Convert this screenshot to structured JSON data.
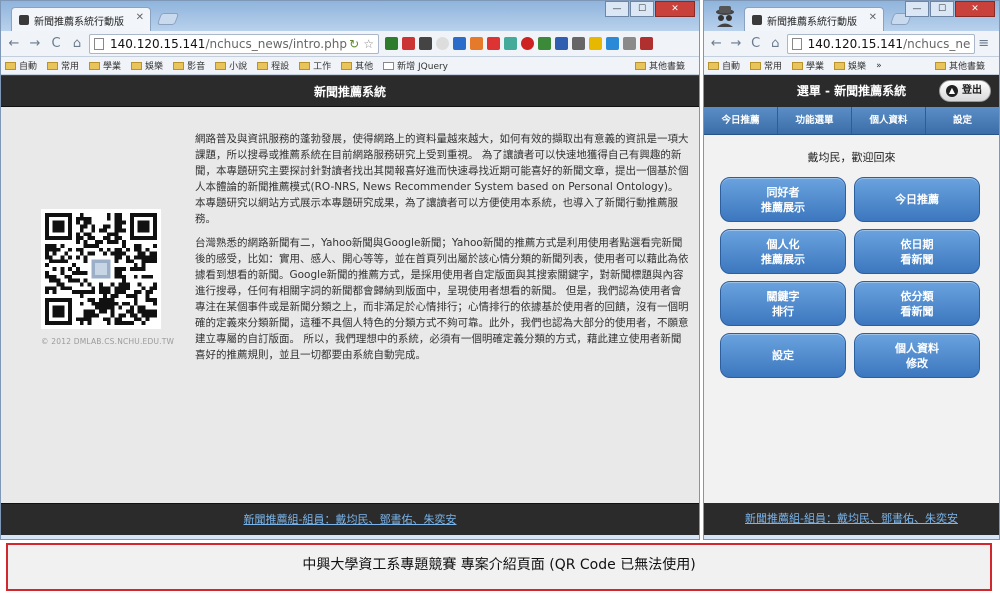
{
  "left_window": {
    "tab_title": "新聞推薦系統行動版",
    "address": {
      "host": "140.120.15.141",
      "path": "/nchucs_news/intro.php"
    },
    "bookmarks": [
      "自動",
      "常用",
      "學業",
      "娛樂",
      "影音",
      "小說",
      "程設",
      "工作",
      "其他",
      "新增 JQuery"
    ],
    "other_bookmarks": "其他書籤",
    "header_title": "新聞推薦系統",
    "qr_copyright": "© 2012 DMLAB.CS.NCHU.EDU.TW",
    "paragraphs": [
      "網路普及與資訊服務的蓬勃發展，使得網路上的資料量越來越大，如何有效的擷取出有意義的資訊是一項大課題，所以搜尋或推薦系統在目前網路服務研究上受到重視。 為了讓讀者可以快速地獲得自己有興趣的新聞，本專題研究主要探討針對讀者找出其閱報喜好進而快速尋找近期可能喜好的新聞文章，提出一個基於個人本體論的新聞推薦模式(RO-NRS, News Recommender System based on Personal Ontology)。 本專題研究以網站方式展示本專題研究成果，為了讓讀者可以方便使用本系統，也導入了新聞行動推薦服務。",
      "台灣熟悉的網路新聞有二，Yahoo新聞與Google新聞；Yahoo新聞的推薦方式是利用使用者點選看完新聞後的感受，比如：實用、感人、開心等等，並在首頁列出屬於該心情分類的新聞列表，使用者可以藉此為依據看到想看的新聞。Google新聞的推薦方式，是採用使用者自定版面與其搜索關鍵字，對新聞標題與內容進行搜尋，任何有相關字詞的新聞都會歸納到版面中，呈現使用者想看的新聞。 但是，我們認為使用者會專注在某個事件或是新聞分類之上，而非滿足於心情排行；心情排行的依據基於使用者的回饋，沒有一個明確的定義來分類新聞，這種不具個人特色的分類方式不夠可靠。此外，我們也認為大部分的使用者，不願意建立專屬的自訂版面。 所以，我們理想中的系統，必須有一個明確定義分類的方式，藉此建立使用者新聞喜好的推薦規則，並且一切都要由系統自動完成。"
    ],
    "footer": "新聞推薦組-組員：戴均民、鄧書佑、朱奕安"
  },
  "right_window": {
    "tab_title": "新聞推薦系統行動版",
    "address": {
      "host": "140.120.15.141",
      "path": "/nchucs_ne"
    },
    "bookmarks": [
      "自動",
      "常用",
      "學業",
      "娛樂"
    ],
    "overflow": "»",
    "other_bookmarks": "其他書籤",
    "header_title": "選單 - 新聞推薦系統",
    "logout_label": "登出",
    "nav": [
      "今日推薦",
      "功能選單",
      "個人資料",
      "設定"
    ],
    "welcome": "戴均民，歡迎回來",
    "buttons": [
      "同好者\n推薦展示",
      "今日推薦",
      "個人化\n推薦展示",
      "依日期\n看新聞",
      "關鍵字\n排行",
      "依分類\n看新聞",
      "設定",
      "個人資料\n修改"
    ],
    "footer": "新聞推薦組-組員：戴均民、鄧書佑、朱奕安"
  },
  "caption": "中興大學資工系專題競賽 專案介紹頁面 (QR Code 已無法使用)",
  "colors": {
    "accent_blue": "#3c77bf",
    "header_dark": "#2b2b2b",
    "caption_border": "#d0282d",
    "link": "#7ab4ea"
  }
}
